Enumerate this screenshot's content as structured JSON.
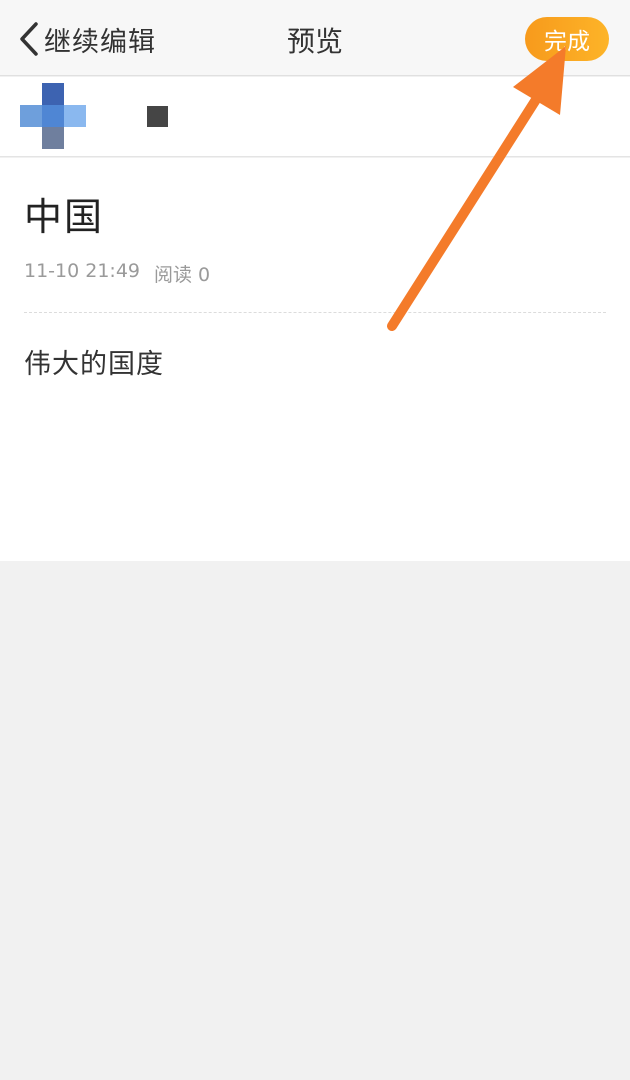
{
  "header": {
    "back_label": "继续编辑",
    "title": "预览",
    "done_label": "完成"
  },
  "article": {
    "title": "中国",
    "date": "11-10 21:49",
    "read_count": "阅读 0",
    "body": "伟大的国度"
  },
  "colors": {
    "accent": "#f9a321",
    "annotation_arrow": "#f47b2a",
    "page_background": "#f1f1f1"
  },
  "icons": {
    "back": "chevron-left-icon",
    "annotation": "pointer-arrow-icon"
  }
}
